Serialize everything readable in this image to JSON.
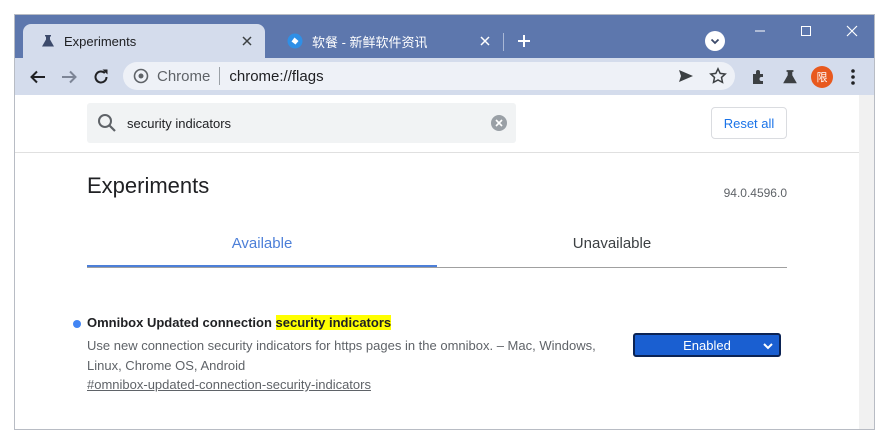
{
  "tabs": [
    {
      "title": "Experiments",
      "active": true
    },
    {
      "title": "软餐 - 新鲜软件资讯",
      "active": false
    }
  ],
  "omnibox": {
    "scheme_label": "Chrome",
    "url": "chrome://flags"
  },
  "profile": {
    "avatar_text": "限"
  },
  "search": {
    "value": "security indicators"
  },
  "reset_label": "Reset all",
  "page": {
    "title": "Experiments",
    "version": "94.0.4596.0"
  },
  "content_tabs": [
    {
      "label": "Available",
      "selected": true
    },
    {
      "label": "Unavailable",
      "selected": false
    }
  ],
  "flag": {
    "name_prefix": "Omnibox Updated connection ",
    "name_highlight": "security indicators",
    "description": "Use new connection security indicators for https pages in the omnibox. – Mac, Windows, Linux, Chrome OS, Android",
    "anchor": "#omnibox-updated-connection-security-indicators",
    "state": "Enabled"
  },
  "colors": {
    "tabstrip": "#5d77ad",
    "toolbar": "#d4dcec",
    "accent": "#4c7fd8",
    "select_bg": "#1a5fd1",
    "highlight": "#ffff00",
    "avatar": "#e8591e"
  }
}
